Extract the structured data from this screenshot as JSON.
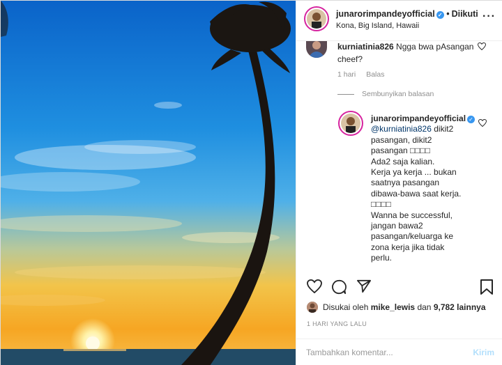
{
  "post": {
    "author": "junarorimpandeyofficial",
    "verified": true,
    "separator": "•",
    "follow_label": "Diikuti",
    "location": "Kona, Big Island, Hawaii",
    "more_icon": "more-horizontal-icon"
  },
  "comments": [
    {
      "username": "kurniatinia826",
      "text": "Ngga bwa pAsangan cheef?",
      "time": "1 hari",
      "reply_label": "Balas"
    }
  ],
  "replies_toggle": "Sembunyikan balasan",
  "reply": {
    "username": "junarorimpandeyofficial",
    "verified": true,
    "mention": "@kurniatinia826",
    "text": " dikit2\npasangan, dikit2\npasangan □□□□\nAda2 saja kalian.\nKerja ya kerja ... bukan\nsaatnya pasangan\ndibawa-bawa saat kerja.\n□□□□\nWanna be successful,\njangan bawa2\npasangan/keluarga ke\nzona kerja jika tidak\nperlu."
  },
  "actions": {
    "like_icon": "heart-icon",
    "comment_icon": "comment-icon",
    "share_icon": "share-icon",
    "save_icon": "bookmark-icon"
  },
  "likes": {
    "prefix": "Disukai oleh",
    "user": "mike_lewis",
    "middle": "dan",
    "count": "9,782 lainnya"
  },
  "date": "1 HARI YANG LALU",
  "add_comment": {
    "placeholder": "Tambahkan komentar...",
    "post_label": "Kirim"
  },
  "colors": {
    "accent_blue": "#3897f0",
    "post_disabled": "#b2dffc",
    "meta_gray": "#8e8e8e"
  }
}
